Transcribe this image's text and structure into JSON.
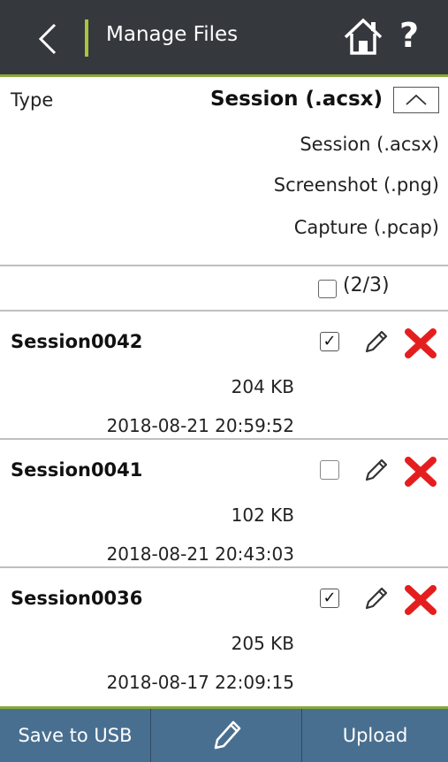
{
  "header": {
    "title": "Manage Files",
    "back_icon": "chevron-left-icon",
    "home_icon": "home-icon",
    "help_label": "?",
    "accent_color": "#a8c43c",
    "background_color": "#35383d"
  },
  "type_filter": {
    "label": "Type",
    "selected": "Session (.acsx)",
    "options": [
      "Session (.acsx)",
      "Screenshot (.png)",
      "Capture (.pcap)"
    ]
  },
  "selection": {
    "select_all_checked": false,
    "count": "(2/3)"
  },
  "files": [
    {
      "name": "Session0042",
      "size": "204 KB",
      "date": "2018-08-21 20:59:52",
      "checked": true
    },
    {
      "name": "Session0041",
      "size": "102 KB",
      "date": "2018-08-21 20:43:03",
      "checked": false
    },
    {
      "name": "Session0036",
      "size": "205 KB",
      "date": "2018-08-17 22:09:15",
      "checked": true
    }
  ],
  "footer": {
    "save_label": "Save to USB",
    "edit_icon": "pencil-icon",
    "upload_label": "Upload",
    "background_color": "#496f90"
  },
  "colors": {
    "delete_red": "#e41e1e"
  }
}
